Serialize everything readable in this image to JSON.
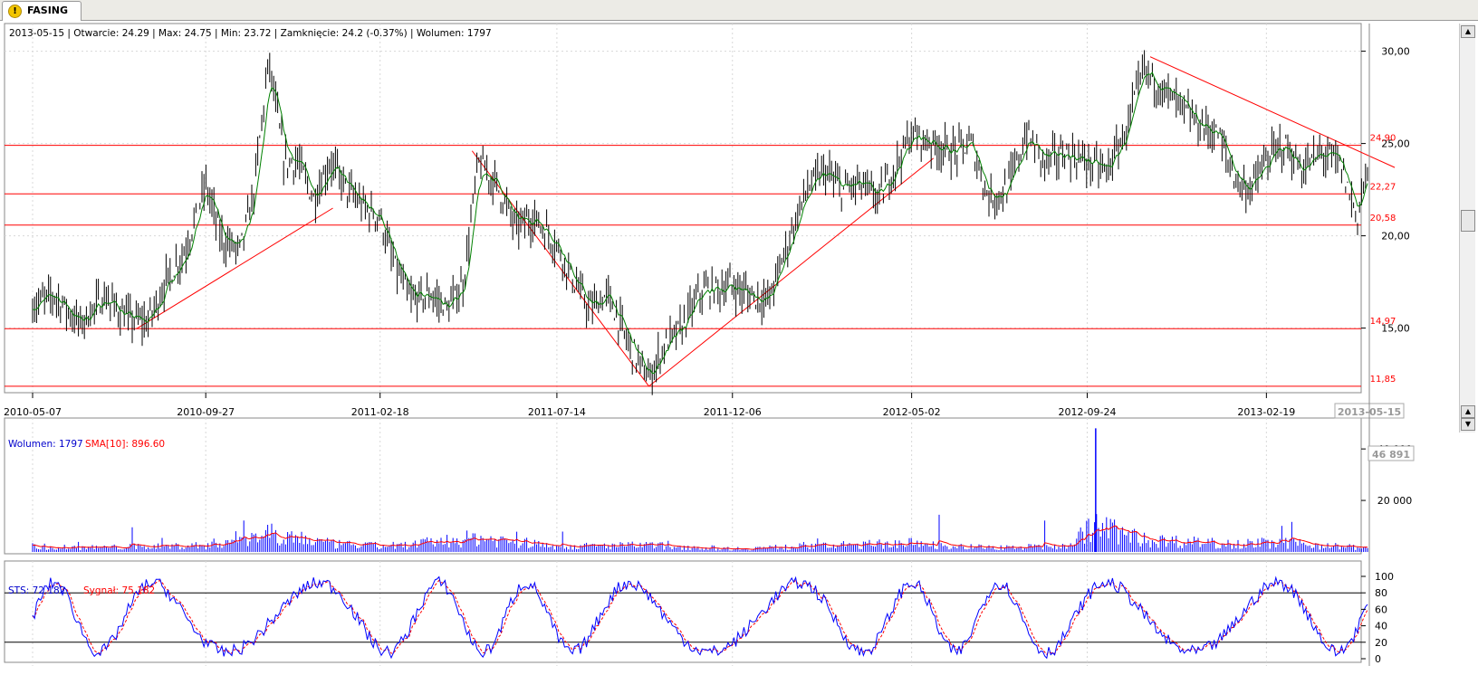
{
  "tab": {
    "label": "FASING",
    "icon": "warning-icon"
  },
  "info_line": "2013-05-15 | Otwarcie: 24.29 | Max: 24.75 | Min: 23.72 | Zamknięcie: 24.2 (-0.37%)  | Wolumen: 1797",
  "volume_legend": {
    "label": "Wolumen: 1797",
    "sma_label": "SMA[10]: 896.60"
  },
  "sts_legend": {
    "label": "STS: 72.182",
    "signal_label": "Sygnał: 75.182"
  },
  "colors": {
    "price": "#000000",
    "sma": "#008000",
    "lines": "#ff0000",
    "volume": "#0000ff",
    "volume_sma": "#ff0000",
    "sts": "#0000ff",
    "signal": "#ff0000"
  },
  "chart_data": [
    {
      "type": "candlestick",
      "title": "FASING",
      "x_ticks": [
        "2010-05-07",
        "2010-09-27",
        "2011-02-18",
        "2011-07-14",
        "2011-12-06",
        "2012-05-02",
        "2012-09-24",
        "2013-02-19"
      ],
      "cursor_date": "2013-05-15",
      "y_ticks": [
        "30,00",
        "25,00",
        "20,00",
        "15,00"
      ],
      "y_range": [
        11.5,
        31.5
      ],
      "horizontal_levels": [
        {
          "value": 24.9,
          "label": "24,90"
        },
        {
          "value": 22.27,
          "label": "22,27"
        },
        {
          "value": 20.58,
          "label": "20,58"
        },
        {
          "value": 14.97,
          "label": "14,97"
        },
        {
          "value": 11.85,
          "label": "11,85"
        }
      ],
      "trend_lines": [
        {
          "from": [
            "2010-08-01",
            14.97
          ],
          "to": [
            "2011-01-10",
            21.5
          ]
        },
        {
          "from": [
            "2011-05-05",
            24.6
          ],
          "to": [
            "2011-09-28",
            11.85
          ]
        },
        {
          "from": [
            "2011-09-28",
            11.85
          ],
          "to": [
            "2012-05-20",
            24.2
          ]
        },
        {
          "from": [
            "2012-11-15",
            29.7
          ],
          "to": [
            "2013-06-05",
            23.7
          ]
        }
      ],
      "close_series": [
        [
          "2010-05-07",
          16.2
        ],
        [
          "2010-05-25",
          16.8
        ],
        [
          "2010-06-15",
          15.2
        ],
        [
          "2010-07-05",
          16.7
        ],
        [
          "2010-07-25",
          15.5
        ],
        [
          "2010-08-10",
          15.3
        ],
        [
          "2010-08-25",
          17.5
        ],
        [
          "2010-09-10",
          19.2
        ],
        [
          "2010-09-27",
          22.8
        ],
        [
          "2010-10-10",
          19.8
        ],
        [
          "2010-10-25",
          19.2
        ],
        [
          "2010-11-05",
          22.0
        ],
        [
          "2010-11-18",
          29.5
        ],
        [
          "2010-12-01",
          24.0
        ],
        [
          "2010-12-12",
          24.0
        ],
        [
          "2010-12-25",
          22.0
        ],
        [
          "2011-01-08",
          24.0
        ],
        [
          "2011-01-22",
          22.5
        ],
        [
          "2011-02-05",
          21.5
        ],
        [
          "2011-02-18",
          21.0
        ],
        [
          "2011-03-01",
          18.5
        ],
        [
          "2011-03-15",
          16.5
        ],
        [
          "2011-04-01",
          16.8
        ],
        [
          "2011-04-15",
          16.0
        ],
        [
          "2011-04-28",
          17.5
        ],
        [
          "2011-05-10",
          24.0
        ],
        [
          "2011-05-25",
          22.8
        ],
        [
          "2011-06-10",
          20.5
        ],
        [
          "2011-06-25",
          21.0
        ],
        [
          "2011-07-14",
          19.5
        ],
        [
          "2011-07-28",
          17.5
        ],
        [
          "2011-08-10",
          16.0
        ],
        [
          "2011-08-25",
          16.8
        ],
        [
          "2011-09-10",
          14.3
        ],
        [
          "2011-09-28",
          12.2
        ],
        [
          "2011-10-10",
          14.0
        ],
        [
          "2011-10-25",
          15.0
        ],
        [
          "2011-11-10",
          17.0
        ],
        [
          "2011-12-06",
          17.3
        ],
        [
          "2011-12-20",
          16.8
        ],
        [
          "2012-01-05",
          16.5
        ],
        [
          "2012-01-20",
          19.5
        ],
        [
          "2012-02-05",
          22.5
        ],
        [
          "2012-02-20",
          23.5
        ],
        [
          "2012-03-05",
          22.5
        ],
        [
          "2012-03-20",
          22.8
        ],
        [
          "2012-04-05",
          22.0
        ],
        [
          "2012-04-20",
          24.0
        ],
        [
          "2012-05-02",
          25.5
        ],
        [
          "2012-05-20",
          25.0
        ],
        [
          "2012-06-05",
          24.5
        ],
        [
          "2012-06-20",
          25.0
        ],
        [
          "2012-07-05",
          22.0
        ],
        [
          "2012-07-20",
          22.5
        ],
        [
          "2012-08-05",
          25.5
        ],
        [
          "2012-08-20",
          24.0
        ],
        [
          "2012-09-05",
          24.5
        ],
        [
          "2012-09-24",
          24.0
        ],
        [
          "2012-10-10",
          23.5
        ],
        [
          "2012-10-25",
          25.5
        ],
        [
          "2012-11-10",
          29.0
        ],
        [
          "2012-11-25",
          28.0
        ],
        [
          "2012-12-10",
          27.0
        ],
        [
          "2012-12-25",
          26.0
        ],
        [
          "2013-01-10",
          25.5
        ],
        [
          "2013-01-25",
          23.0
        ],
        [
          "2013-02-05",
          22.5
        ],
        [
          "2013-02-19",
          24.0
        ],
        [
          "2013-03-05",
          25.0
        ],
        [
          "2013-03-20",
          23.5
        ],
        [
          "2013-04-05",
          24.5
        ],
        [
          "2013-04-20",
          24.0
        ],
        [
          "2013-05-05",
          21.0
        ],
        [
          "2013-05-15",
          24.2
        ]
      ],
      "volume_y_ticks": [
        "40 000",
        "20 000"
      ],
      "volume_last_label": "46 891",
      "volume_series": [
        [
          "2010-05-07",
          2500
        ],
        [
          "2010-07-01",
          2000
        ],
        [
          "2010-09-27",
          3000
        ],
        [
          "2010-11-18",
          9000
        ],
        [
          "2011-01-10",
          3500
        ],
        [
          "2011-03-01",
          2500
        ],
        [
          "2011-05-10",
          6500
        ],
        [
          "2011-07-14",
          2500
        ],
        [
          "2011-09-28",
          3000
        ],
        [
          "2011-12-06",
          1500
        ],
        [
          "2012-02-05",
          2500
        ],
        [
          "2012-05-02",
          4000
        ],
        [
          "2012-07-05",
          2000
        ],
        [
          "2012-09-05",
          2500
        ],
        [
          "2012-10-01",
          12000
        ],
        [
          "2012-11-10",
          5500
        ],
        [
          "2013-01-10",
          4000
        ],
        [
          "2013-03-05",
          4000
        ],
        [
          "2013-05-15",
          1797
        ]
      ],
      "sts_y_ticks": [
        "100",
        "80",
        "60",
        "40",
        "20",
        "0"
      ],
      "sts_levels": [
        80,
        20
      ],
      "sts_last": 72.182,
      "signal_last": 75.182
    }
  ]
}
